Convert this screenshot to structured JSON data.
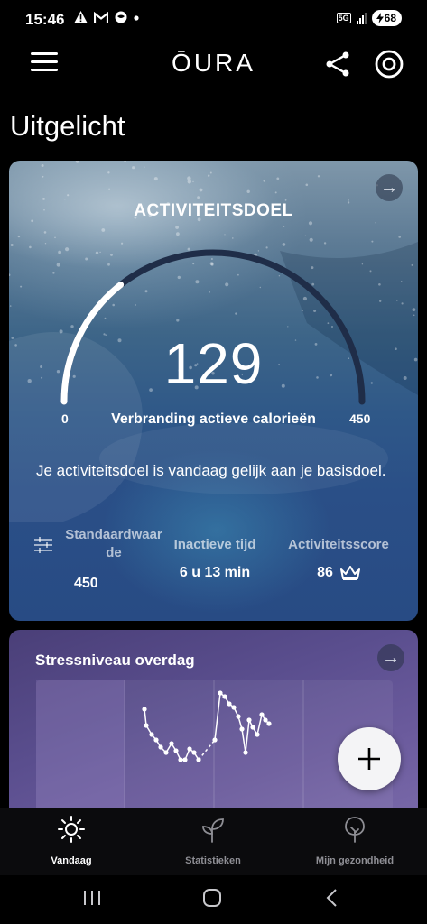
{
  "status_bar": {
    "time": "15:46",
    "left_icons": [
      "alert-icon",
      "gmail-icon",
      "vpn-icon",
      "dot-icon"
    ],
    "network": "5G",
    "battery": "68"
  },
  "header": {
    "logo": "ŌURA",
    "icons": [
      "menu-icon",
      "share-icon",
      "ring-icon"
    ]
  },
  "section_title": "Uitgelicht",
  "activity_card": {
    "title": "ACTIVITEITSDOEL",
    "value": "129",
    "gauge_min": "0",
    "gauge_max": "450",
    "gauge_progress": 0.287,
    "gauge_label": "Verbranding actieve calorieën",
    "description": "Je activiteitsdoel is vandaag gelijk aan je basisdoel.",
    "stats": [
      {
        "label": "Standaardwaar de",
        "value": "450"
      },
      {
        "label": "Inactieve tijd",
        "value": "6 u 13 min"
      },
      {
        "label": "Activiteitsscore",
        "value": "86"
      }
    ],
    "colors": {
      "gauge_fill": "#ffffff",
      "gauge_track": "#1f2d48"
    }
  },
  "stress_card": {
    "title": "Stressniveau overdag"
  },
  "fab": {
    "icon": "plus-icon"
  },
  "bottom_nav": [
    {
      "label": "Vandaag",
      "icon": "sun-icon",
      "active": true
    },
    {
      "label": "Statistieken",
      "icon": "sprout-icon",
      "active": false
    },
    {
      "label": "Mijn gezondheid",
      "icon": "tree-icon",
      "active": false
    }
  ],
  "system_nav": [
    "recent-apps-icon",
    "home-icon",
    "back-icon"
  ]
}
